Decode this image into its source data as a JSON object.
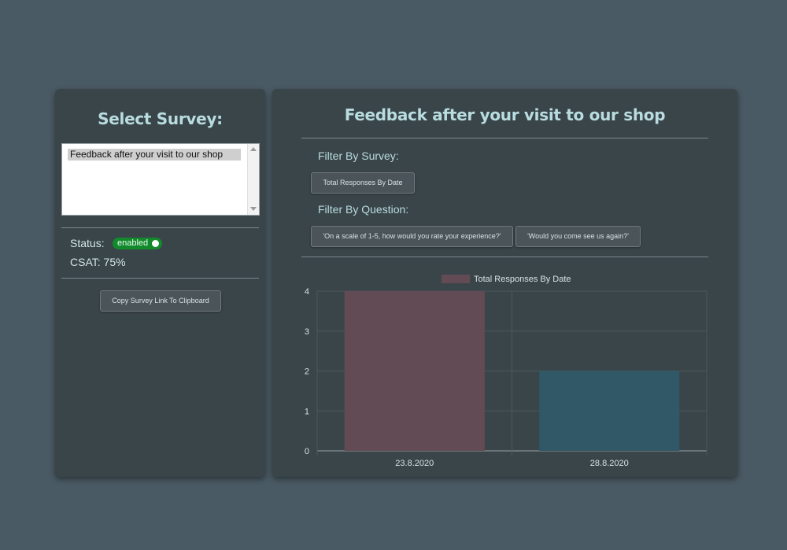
{
  "left_panel": {
    "title": "Select Survey:",
    "survey_list": {
      "selected": "Feedback after your visit to our shop"
    },
    "status": {
      "label": "Status:",
      "toggle_label": "enabled",
      "enabled": true
    },
    "csat": "CSAT: 75%",
    "copy_button": "Copy Survey Link To Clipboard"
  },
  "main": {
    "title": "Feedback after your visit to our shop",
    "filter_survey_label": "Filter By Survey:",
    "survey_buttons": [
      "Total Responses By Date"
    ],
    "filter_question_label": "Filter By Question:",
    "question_buttons": [
      "'On a scale of 1-5, how would you rate your experience?'",
      "'Would you come see us again?'"
    ]
  },
  "colors": {
    "background": "#4a5a64",
    "panel": "#3a4549",
    "title": "#b8dce0",
    "toggle_on": "#128a2c",
    "bar_1": "#634b55",
    "bar_2": "#305866"
  },
  "chart_data": {
    "type": "bar",
    "categories": [
      "23.8.2020",
      "28.8.2020"
    ],
    "series": [
      {
        "name": "Total Responses By Date",
        "values": [
          4,
          2
        ]
      }
    ],
    "bar_colors": [
      "#634b55",
      "#305866"
    ],
    "legend_position": "top",
    "ylim": [
      0,
      4
    ],
    "yticks": [
      0,
      1,
      2,
      3,
      4
    ],
    "grid": true
  }
}
